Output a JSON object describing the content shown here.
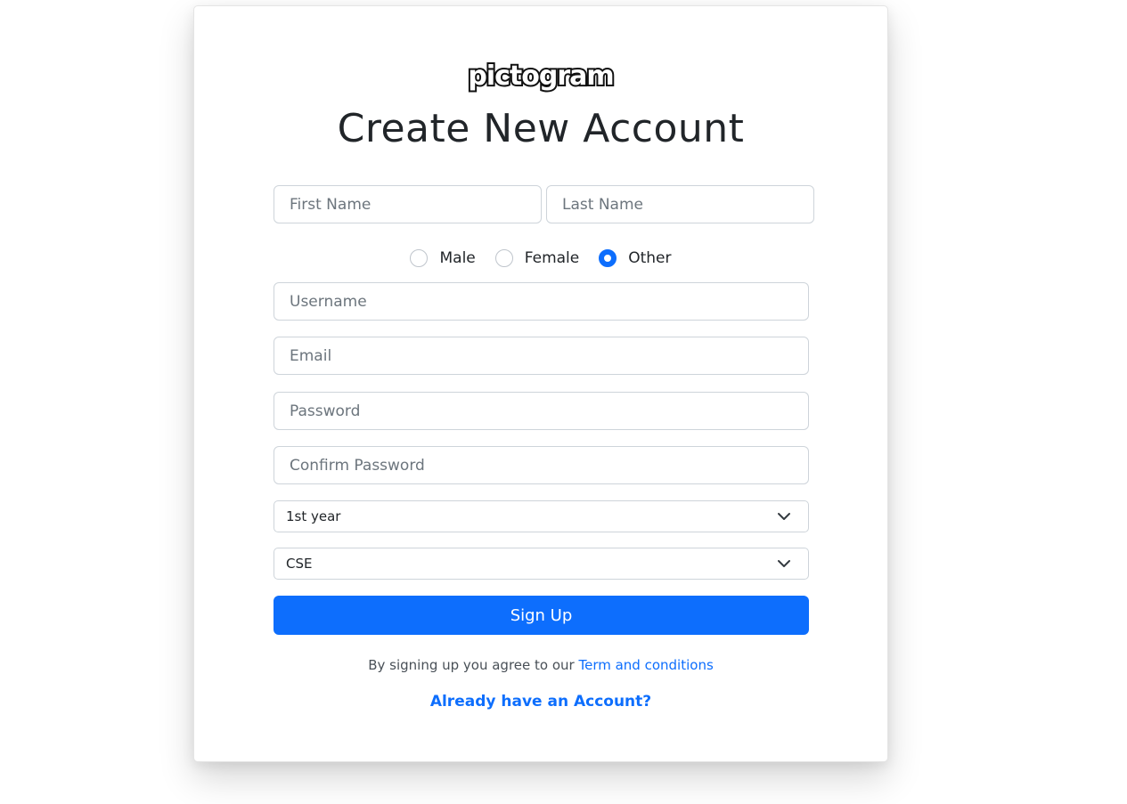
{
  "logo": {
    "text": "pictogram"
  },
  "title": "Create New Account",
  "form": {
    "first_name": {
      "placeholder": "First Name",
      "value": ""
    },
    "last_name": {
      "placeholder": "Last Name",
      "value": ""
    },
    "gender": {
      "options": [
        "Male",
        "Female",
        "Other"
      ],
      "selected": "Other"
    },
    "username": {
      "placeholder": "Username",
      "value": ""
    },
    "email": {
      "placeholder": "Email",
      "value": ""
    },
    "password": {
      "placeholder": "Password",
      "value": ""
    },
    "confirm_password": {
      "placeholder": "Confirm Password",
      "value": ""
    },
    "year_select": {
      "selected": "1st year"
    },
    "branch_select": {
      "selected": "CSE"
    },
    "submit_label": "Sign Up"
  },
  "terms": {
    "prefix": "By signing up you agree to our",
    "link_label": "Term and conditions"
  },
  "login_link": "Already have an Account?",
  "colors": {
    "accent": "#0d6efd",
    "text": "#212529",
    "border": "#ced4da",
    "placeholder": "#6c757d"
  }
}
